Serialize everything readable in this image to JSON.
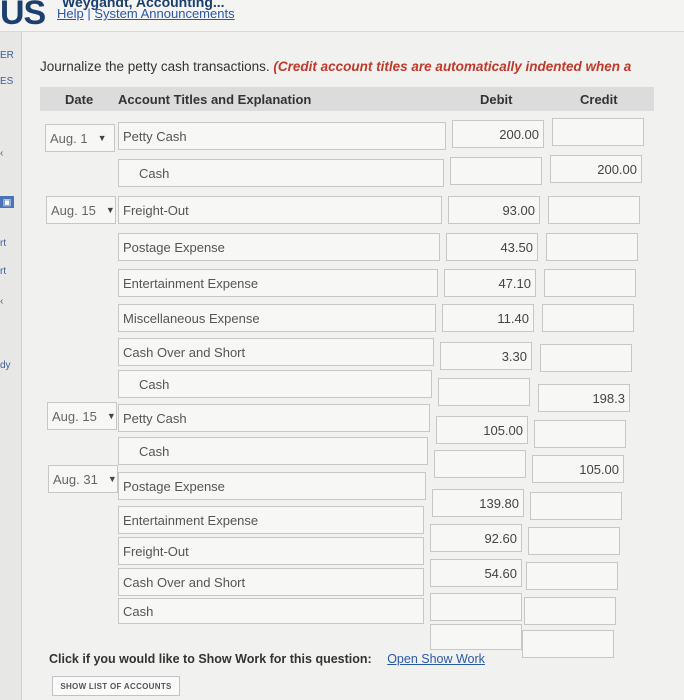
{
  "header": {
    "brand": "US",
    "title_partial": "Weygandt, Accounting...",
    "help_label": "Help",
    "separator": "|",
    "announcements_label": "System Announcements"
  },
  "sidebar": {
    "items": [
      "ER",
      "ES",
      "rt",
      "rt",
      "dy"
    ]
  },
  "instruction": {
    "text": "Journalize the petty cash transactions. ",
    "emphasis": "(Credit account titles are automatically indented when a"
  },
  "table": {
    "headers": {
      "date": "Date",
      "account": "Account Titles and Explanation",
      "debit": "Debit",
      "credit": "Credit"
    },
    "rows": [
      {
        "date": "Aug. 1",
        "account": "Petty Cash",
        "debit": "200.00",
        "credit": ""
      },
      {
        "date": "",
        "account": "Cash",
        "debit": "",
        "credit": "200.00"
      },
      {
        "date": "Aug. 15",
        "account": "Freight-Out",
        "debit": "93.00",
        "credit": ""
      },
      {
        "date": "",
        "account": "Postage Expense",
        "debit": "43.50",
        "credit": ""
      },
      {
        "date": "",
        "account": "Entertainment Expense",
        "debit": "47.10",
        "credit": ""
      },
      {
        "date": "",
        "account": "Miscellaneous Expense",
        "debit": "11.40",
        "credit": ""
      },
      {
        "date": "",
        "account": "Cash Over and Short",
        "debit": "3.30",
        "credit": ""
      },
      {
        "date": "",
        "account": "Cash",
        "debit": "",
        "credit": "198.3"
      },
      {
        "date": "Aug. 15",
        "account": "Petty Cash",
        "debit": "105.00",
        "credit": ""
      },
      {
        "date": "",
        "account": "Cash",
        "debit": "",
        "credit": "105.00"
      },
      {
        "date": "Aug. 31",
        "account": "Postage Expense",
        "debit": "139.80",
        "credit": ""
      },
      {
        "date": "",
        "account": "Entertainment Expense",
        "debit": "92.60",
        "credit": ""
      },
      {
        "date": "",
        "account": "Freight-Out",
        "debit": "54.60",
        "credit": ""
      },
      {
        "date": "",
        "account": "Cash Over and Short",
        "debit": "",
        "credit": ""
      },
      {
        "date": "",
        "account": "Cash",
        "debit": "",
        "credit": ""
      }
    ]
  },
  "show_work": {
    "prompt": "Click if you would like to Show Work for this question:",
    "link": "Open Show Work"
  },
  "list_button": "SHOW LIST OF ACCOUNTS"
}
